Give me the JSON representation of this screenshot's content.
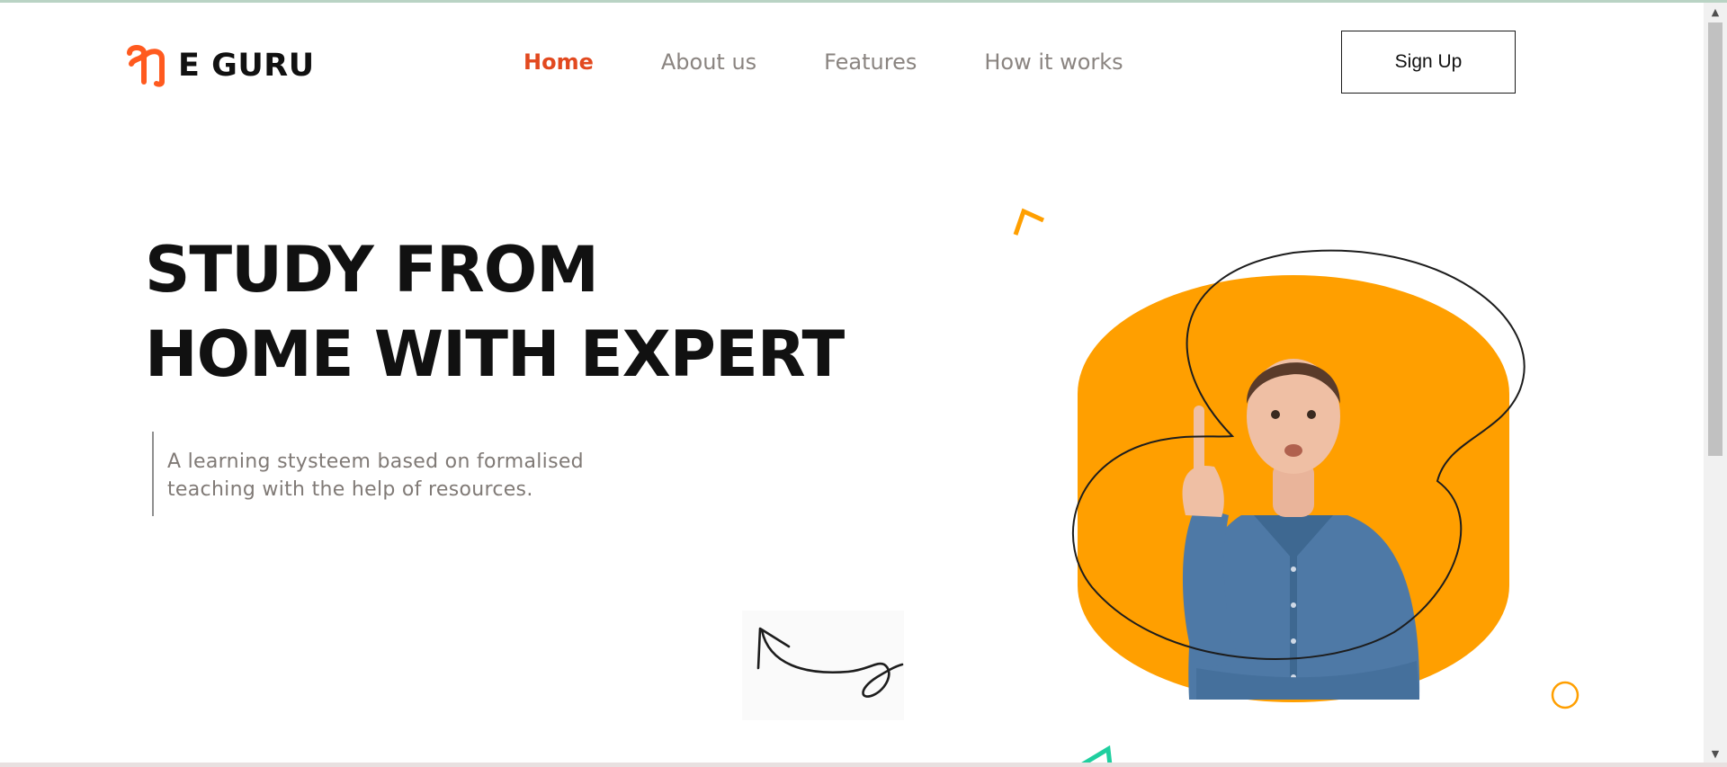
{
  "brand": {
    "name": "E GURU",
    "logo_icon": "eguru-logo-icon",
    "accent": "#ff5a1f"
  },
  "nav": {
    "items": [
      {
        "label": "Home",
        "active": true
      },
      {
        "label": "About us",
        "active": false
      },
      {
        "label": "Features",
        "active": false
      },
      {
        "label": "How it works",
        "active": false
      }
    ],
    "active_color": "#e2491f",
    "inactive_color": "#8a8480"
  },
  "header": {
    "signup_label": "Sign Up"
  },
  "hero": {
    "title_line1": "STUDY FROM",
    "title_line2": "HOME WITH EXPERT",
    "tagline_line1": "A learning stysteem based on formalised",
    "tagline_line2": "teaching with the help of resources.",
    "blob_color": "#ff9f00",
    "image": "teacher-pointing-up-photo"
  },
  "decorations": {
    "orange_chevron": "chevron-up-icon",
    "orange_ring": "circle-icon",
    "teal_triangle": "triangle-icon",
    "curved_arrow": "curved-arrow-icon",
    "orange_color": "#ff9f00",
    "teal_color": "#1fcf9f"
  },
  "scrollbar": {
    "up": "▲",
    "down": "▼"
  }
}
